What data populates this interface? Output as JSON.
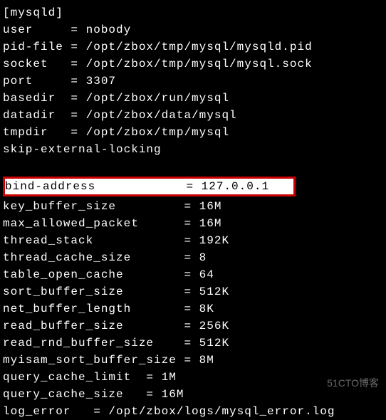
{
  "section_header": "[mysqld]",
  "top_block": [
    "user     = nobody",
    "pid-file = /opt/zbox/tmp/mysql/mysqld.pid",
    "socket   = /opt/zbox/tmp/mysql/mysql.sock",
    "port     = 3307",
    "basedir  = /opt/zbox/run/mysql",
    "datadir  = /opt/zbox/data/mysql",
    "tmpdir   = /opt/zbox/tmp/mysql",
    "skip-external-locking"
  ],
  "highlighted": "bind-address            = 127.0.0.1   ",
  "bottom_block": [
    "key_buffer_size         = 16M",
    "max_allowed_packet      = 16M",
    "thread_stack            = 192K",
    "thread_cache_size       = 8",
    "table_open_cache        = 64",
    "sort_buffer_size        = 512K",
    "net_buffer_length       = 8K",
    "read_buffer_size        = 256K",
    "read_rnd_buffer_size    = 512K",
    "myisam_sort_buffer_size = 8M",
    "query_cache_limit  = 1M",
    "query_cache_size   = 16M",
    "log_error   = /opt/zbox/logs/mysql_error.log"
  ],
  "watermark": "51CTO博客"
}
